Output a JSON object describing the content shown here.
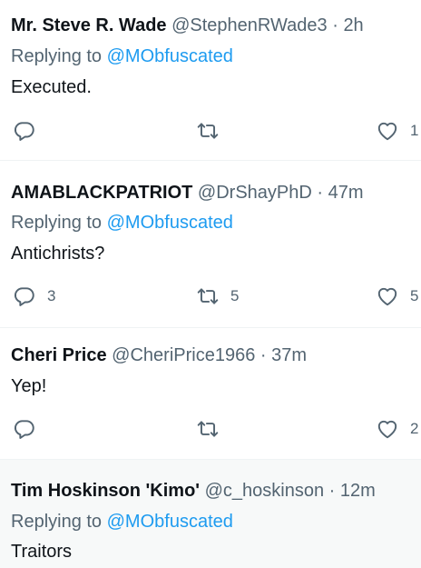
{
  "tweets": [
    {
      "name": "Mr. Steve R. Wade",
      "handle": "@StephenRWade3",
      "separator": "·",
      "time": "2h",
      "replying_prefix": "Replying to",
      "replying_to": "@MObfuscated",
      "text": "Executed.",
      "replies": "",
      "retweets": "",
      "likes": "1"
    },
    {
      "name": "AMABLACKPATRIOT",
      "handle": "@DrShayPhD",
      "separator": "·",
      "time": "47m",
      "replying_prefix": "Replying to",
      "replying_to": "@MObfuscated",
      "text": "Antichrists?",
      "replies": "3",
      "retweets": "5",
      "likes": "5"
    },
    {
      "name": "Cheri Price",
      "handle": "@CheriPrice1966",
      "separator": "·",
      "time": "37m",
      "text": "Yep!",
      "replies": "",
      "retweets": "",
      "likes": "2"
    },
    {
      "name": "Tim Hoskinson 'Kimo'",
      "handle": "@c_hoskinson",
      "separator": "·",
      "time": "12m",
      "replying_prefix": "Replying to",
      "replying_to": "@MObfuscated",
      "text": "Traitors"
    }
  ],
  "icons": {
    "reply": "reply-icon",
    "retweet": "retweet-icon",
    "like": "heart-icon"
  },
  "colors": {
    "name": "#0f1419",
    "meta": "#536471",
    "mention": "#1d9bf0",
    "highlight_bg": "#f7f9f9"
  }
}
